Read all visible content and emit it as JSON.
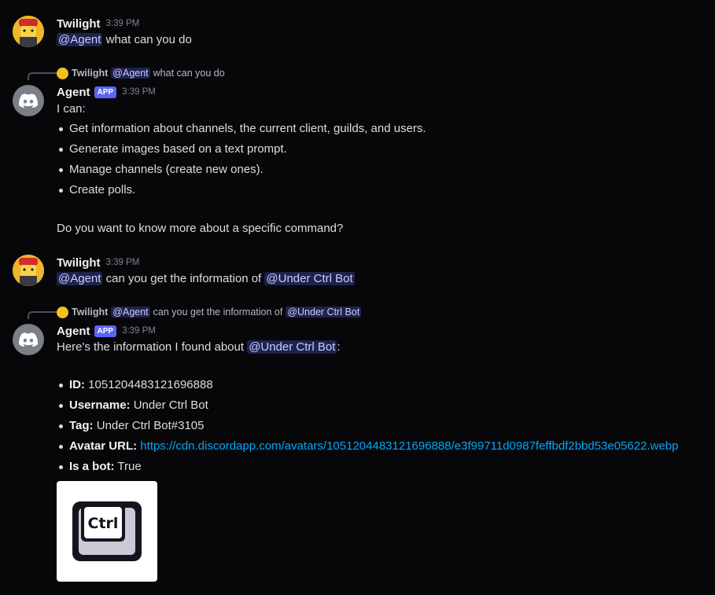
{
  "messages": [
    {
      "author": "Twilight",
      "time": "3:39 PM",
      "mention": "@Agent",
      "text": " what can you do"
    },
    {
      "reply": {
        "author": "Twilight",
        "mention": "@Agent",
        "text": "what can you do"
      },
      "author": "Agent",
      "badge": "APP",
      "time": "3:39 PM",
      "intro": "I can:",
      "bullets": [
        "Get information about channels, the current client, guilds, and users.",
        "Generate images based on a text prompt.",
        "Manage channels (create new ones).",
        "Create polls."
      ],
      "outro": "Do you want to know more about a specific command?"
    },
    {
      "author": "Twilight",
      "time": "3:39 PM",
      "mention": "@Agent",
      "text": " can you get the information of ",
      "mention2": "@Under Ctrl Bot"
    },
    {
      "reply": {
        "author": "Twilight",
        "mention": "@Agent",
        "text": "can you get the information of",
        "mention2": "@Under Ctrl Bot"
      },
      "author": "Agent",
      "badge": "APP",
      "time": "3:39 PM",
      "intro_before": "Here's the information I found about ",
      "intro_mention": "@Under Ctrl Bot",
      "intro_after": ":",
      "fields": [
        {
          "label": "ID:",
          "value": " 1051204483121696888"
        },
        {
          "label": "Username:",
          "value": " Under Ctrl Bot"
        },
        {
          "label": "Tag:",
          "value": " Under Ctrl Bot#3105"
        },
        {
          "label": "Avatar URL:",
          "value": " https://cdn.discordapp.com/avatars/1051204483121696888/e3f99711d0987feffbdf2bbd53e05622.webp"
        },
        {
          "label": "Is a bot:",
          "value": " True"
        }
      ],
      "image_key_text": "Ctrl"
    }
  ],
  "colors": {
    "background": "#070709",
    "mention_bg": "#3c4270",
    "link": "#00a8fc",
    "app_badge": "#5865f2"
  }
}
